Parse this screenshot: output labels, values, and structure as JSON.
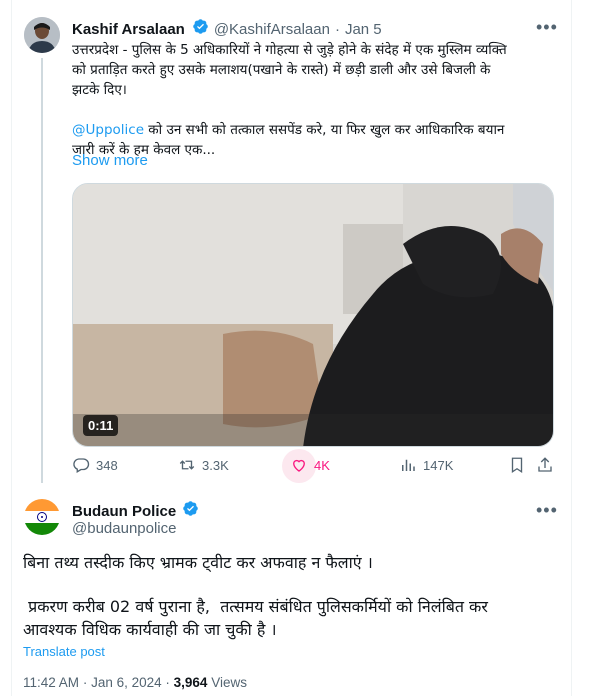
{
  "tweet": {
    "author_name": "Kashif Arsalaan",
    "author_handle": "@KashifArsalaan",
    "separator": "·",
    "date": "Jan 5",
    "text_line1": "उत्तरप्रदेश - पुलिस के 5 अधिकारियों ने गोहत्या से जुड़े होने के संदेह में एक मुस्लिम व्यक्ति",
    "text_line2": "को प्रताड़ित करते हुए उसके मलाशय(पखाने के रास्ते) में छड़ी डाली और उसे बिजली के",
    "text_line3": "झटके दिए।",
    "mention": "@Uppolice",
    "text_line4_rest": " को उन सभी को तत्काल ससपेंड करे, या फिर खुल कर आधिकारिक बयान",
    "text_line5": "जारी करें के हम केवल एक...",
    "show_more": "Show more",
    "video_duration": "0:11",
    "actions": {
      "replies": "348",
      "reposts": "3.3K",
      "likes": "4K",
      "views": "147K"
    },
    "icons": [
      "reply-icon",
      "repost-icon",
      "like-icon",
      "views-icon",
      "bookmark-icon",
      "share-icon",
      "more-icon",
      "verified-icon"
    ]
  },
  "reply": {
    "author_name": "Budaun Police",
    "author_handle": "@budaunpolice",
    "text_line1": "बिना तथ्य तस्दीक किए भ्रामक ट्वीट कर अफवाह न फैलाएं ।",
    "text_line2": " प्रकरण करीब 02 वर्ष पुराना है,  तत्समय संबंधित पुलिसकर्मियों को निलंबित कर",
    "text_line3": "आवश्यक विधिक कार्यवाही की जा चुकी है ।",
    "translate": "Translate post",
    "time": "11:42 AM",
    "date": "Jan 6, 2024",
    "views_count": "3,964",
    "views_label": "Views"
  },
  "colors": {
    "accent": "#1d9bf0",
    "secondary_text": "#536471",
    "like_highlight": "#f91880",
    "verified": "#1d9bf0"
  }
}
